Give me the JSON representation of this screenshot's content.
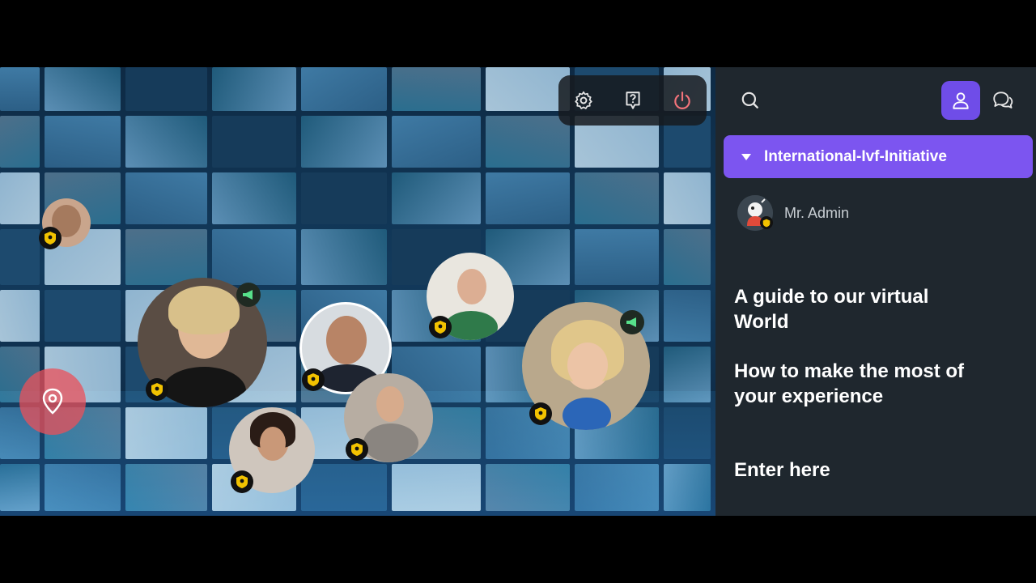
{
  "toolbar": {
    "settings_icon": "gear-icon",
    "help_icon": "question-icon",
    "power_icon": "power-icon",
    "power_color": "#f2737a"
  },
  "sidebar": {
    "search_icon": "search-icon",
    "user_icon": "user-icon",
    "chat_icon": "chat-icon",
    "accent_color": "#7c55f0",
    "room": {
      "name": "International-Ivf-Initiative"
    },
    "members": [
      {
        "name": "Mr. Admin"
      }
    ],
    "guide": {
      "line1": "A guide to our virtual",
      "line2": "World",
      "line3": "How to make the most of",
      "line4": "your experience",
      "enter": "Enter here"
    }
  },
  "world": {
    "location_pin_icon": "location-pin-icon",
    "participant_badge_icon": "shield-badge-icon",
    "speaker_icon": "megaphone-icon"
  }
}
